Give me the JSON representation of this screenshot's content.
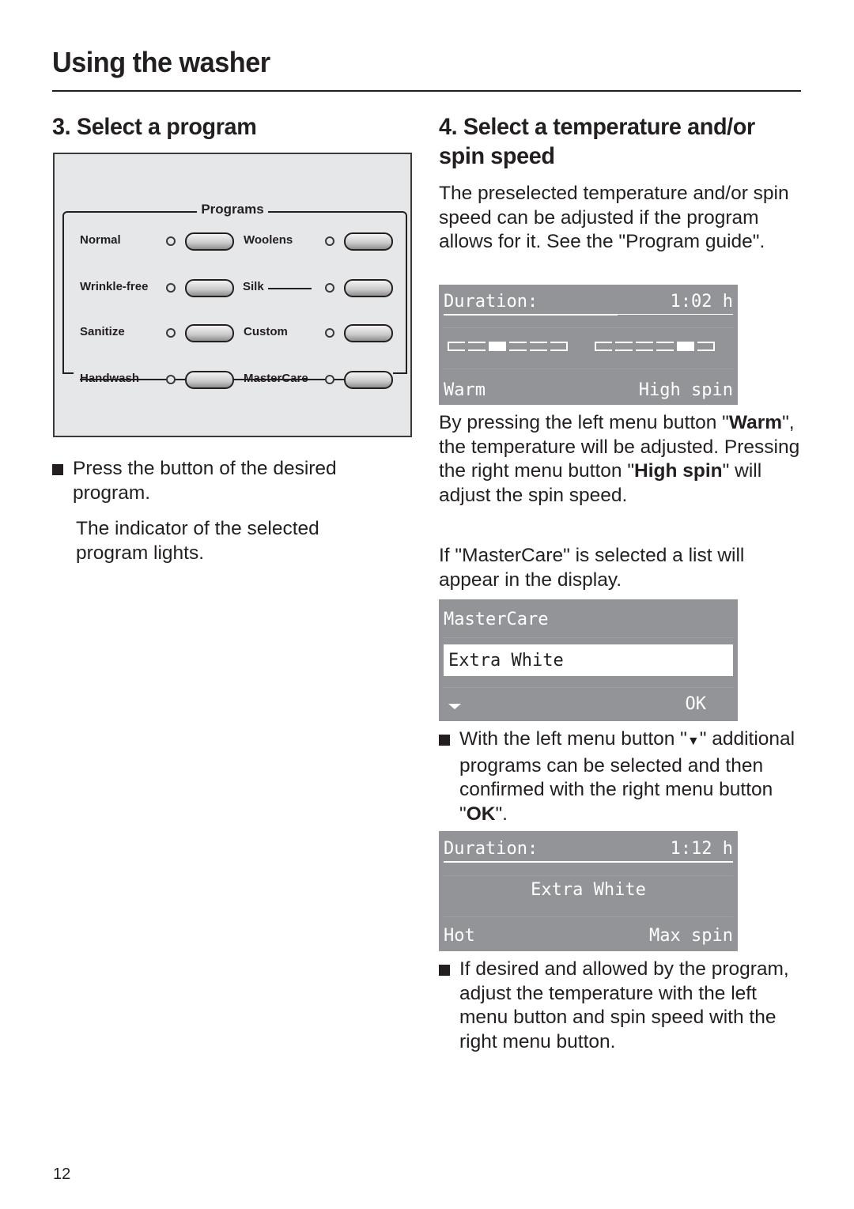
{
  "header": {
    "title": "Using the washer"
  },
  "left": {
    "section_title": "3. Select a program",
    "panel": {
      "group_label": "Programs",
      "programs": [
        {
          "label": "Normal",
          "selected": false
        },
        {
          "label": "Woolens",
          "selected": false
        },
        {
          "label": "Wrinkle-free",
          "selected": false
        },
        {
          "label": "Silk",
          "selected": false
        },
        {
          "label": "Sanitize",
          "selected": false
        },
        {
          "label": "Custom",
          "selected": false
        },
        {
          "label": "Handwash",
          "selected": false
        },
        {
          "label": "MasterCare",
          "selected": false
        }
      ]
    },
    "bullet1": "Press the button of the desired program.",
    "note1": "The indicator of the selected program lights."
  },
  "right": {
    "section_title": "4. Select a temperature and/or spin speed",
    "intro": "The preselected temperature and/or spin speed can be adjusted if the program allows for it. See the \"Program guide\".",
    "display1": {
      "label": "Duration:",
      "value": "1:02 h",
      "temperature_segments": 6,
      "temperature_level": 3,
      "spin_segments": 6,
      "spin_level": 5,
      "left_button": "Warm",
      "right_button": "High spin"
    },
    "para2": {
      "t1": "By pressing the left menu button \"",
      "b1": "Warm",
      "t2": "\", the temperature will be adjusted. Pressing the right menu button \"",
      "b2": "High spin",
      "t3": "\" will adjust the spin speed."
    },
    "para3": "If \"MasterCare\" is selected a list will appear in the display.",
    "display2": {
      "title": "MasterCare",
      "selected_item": "Extra White",
      "left_button_icon": "down-arrow-icon",
      "right_button": "OK"
    },
    "bullet2": {
      "t1": "With the left menu button \"",
      "icon": "▼",
      "t2": "\" additional programs can be selected and then confirmed with the right menu button \"",
      "b1": "OK",
      "t3": "\"."
    },
    "display3": {
      "label": "Duration:",
      "value": "1:12 h",
      "program": "Extra White",
      "left_button": "Hot",
      "right_button": "Max spin"
    },
    "bullet3": "If desired and allowed by the program, adjust the temperature with the left menu button and spin speed with the right menu button."
  },
  "footer": {
    "page_number": "12"
  }
}
